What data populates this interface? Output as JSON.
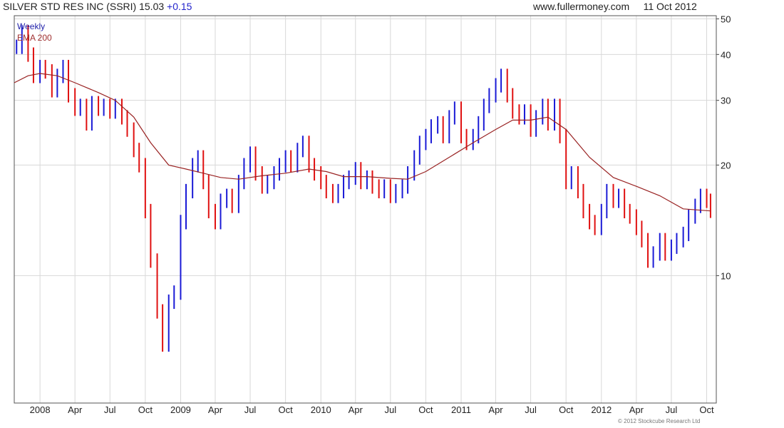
{
  "header": {
    "name_price": "SILVER STD RES INC (SSRI) 15.03",
    "change": "+0.15",
    "source": "www.fullermoney.com",
    "date": "11 Oct 2012"
  },
  "legend": {
    "series1": "Weekly",
    "series2": "EMA 200"
  },
  "copyright": "© 2012 Stockcube Research Ltd",
  "colors": {
    "up": "#1a1ad6",
    "down": "#e01010",
    "ema": "#992222",
    "grid": "#d8d8d8"
  },
  "chart_data": {
    "type": "line",
    "title": "SILVER STD RES INC (SSRI) 15.03 +0.15",
    "y_scale": "log",
    "ylim": [
      4.5,
      51
    ],
    "yticks": [
      10,
      20,
      30,
      40,
      50
    ],
    "xlim": [
      "2007-10-26",
      "2012-10-26"
    ],
    "x_tick_labels": [
      {
        "label": "2008",
        "date": "2008-01-01"
      },
      {
        "label": "Apr",
        "date": "2008-04-01"
      },
      {
        "label": "Jul",
        "date": "2008-07-01"
      },
      {
        "label": "Oct",
        "date": "2008-10-01"
      },
      {
        "label": "2009",
        "date": "2009-01-01"
      },
      {
        "label": "Apr",
        "date": "2009-04-01"
      },
      {
        "label": "Jul",
        "date": "2009-07-01"
      },
      {
        "label": "Oct",
        "date": "2009-10-01"
      },
      {
        "label": "2010",
        "date": "2010-01-01"
      },
      {
        "label": "Apr",
        "date": "2010-04-01"
      },
      {
        "label": "Jul",
        "date": "2010-07-01"
      },
      {
        "label": "Oct",
        "date": "2010-10-01"
      },
      {
        "label": "2011",
        "date": "2011-01-01"
      },
      {
        "label": "Apr",
        "date": "2011-04-01"
      },
      {
        "label": "Jul",
        "date": "2011-07-01"
      },
      {
        "label": "Oct",
        "date": "2011-10-01"
      },
      {
        "label": "2012",
        "date": "2012-01-01"
      },
      {
        "label": "Apr",
        "date": "2012-04-01"
      },
      {
        "label": "Jul",
        "date": "2012-07-01"
      },
      {
        "label": "Oct",
        "date": "2012-10-01"
      }
    ],
    "series": [
      {
        "name": "Weekly",
        "points": [
          [
            "2007-11-01",
            42
          ],
          [
            "2007-11-15",
            46
          ],
          [
            "2007-12-01",
            40
          ],
          [
            "2007-12-15",
            35
          ],
          [
            "2008-01-01",
            37
          ],
          [
            "2008-01-15",
            36
          ],
          [
            "2008-02-01",
            32
          ],
          [
            "2008-02-15",
            35
          ],
          [
            "2008-03-01",
            37
          ],
          [
            "2008-03-15",
            31
          ],
          [
            "2008-04-01",
            28.5
          ],
          [
            "2008-04-15",
            29
          ],
          [
            "2008-05-01",
            26
          ],
          [
            "2008-05-15",
            29.5
          ],
          [
            "2008-06-01",
            28.5
          ],
          [
            "2008-06-15",
            29
          ],
          [
            "2008-07-01",
            28
          ],
          [
            "2008-07-15",
            29
          ],
          [
            "2008-08-01",
            27
          ],
          [
            "2008-08-15",
            25
          ],
          [
            "2008-09-01",
            22
          ],
          [
            "2008-09-15",
            20
          ],
          [
            "2008-10-01",
            15
          ],
          [
            "2008-10-15",
            11
          ],
          [
            "2008-11-01",
            8
          ],
          [
            "2008-11-15",
            6.5
          ],
          [
            "2008-12-01",
            8.5
          ],
          [
            "2008-12-15",
            9
          ],
          [
            "2009-01-01",
            14
          ],
          [
            "2009-01-15",
            17
          ],
          [
            "2009-02-01",
            20
          ],
          [
            "2009-02-15",
            21
          ],
          [
            "2009-03-01",
            18
          ],
          [
            "2009-03-15",
            15
          ],
          [
            "2009-04-01",
            14
          ],
          [
            "2009-04-15",
            16
          ],
          [
            "2009-05-01",
            16.5
          ],
          [
            "2009-05-15",
            15.5
          ],
          [
            "2009-06-01",
            18
          ],
          [
            "2009-06-15",
            20
          ],
          [
            "2009-07-01",
            21.5
          ],
          [
            "2009-07-15",
            19
          ],
          [
            "2009-08-01",
            17.5
          ],
          [
            "2009-08-15",
            18
          ],
          [
            "2009-09-01",
            19
          ],
          [
            "2009-09-15",
            20
          ],
          [
            "2009-10-01",
            21
          ],
          [
            "2009-10-15",
            20
          ],
          [
            "2009-11-01",
            22
          ],
          [
            "2009-11-15",
            23
          ],
          [
            "2009-12-01",
            20
          ],
          [
            "2009-12-15",
            19
          ],
          [
            "2010-01-01",
            18
          ],
          [
            "2010-01-15",
            17
          ],
          [
            "2010-02-01",
            16.5
          ],
          [
            "2010-02-15",
            17
          ],
          [
            "2010-03-01",
            18
          ],
          [
            "2010-03-15",
            18.5
          ],
          [
            "2010-04-01",
            19.5
          ],
          [
            "2010-04-15",
            18
          ],
          [
            "2010-05-01",
            18.5
          ],
          [
            "2010-05-15",
            17.5
          ],
          [
            "2010-06-01",
            17
          ],
          [
            "2010-06-15",
            17.5
          ],
          [
            "2010-07-01",
            16.5
          ],
          [
            "2010-07-15",
            17
          ],
          [
            "2010-08-01",
            17.5
          ],
          [
            "2010-08-15",
            19
          ],
          [
            "2010-09-01",
            21
          ],
          [
            "2010-09-15",
            23
          ],
          [
            "2010-10-01",
            24
          ],
          [
            "2010-10-15",
            25.5
          ],
          [
            "2010-11-01",
            26
          ],
          [
            "2010-11-15",
            24
          ],
          [
            "2010-12-01",
            27
          ],
          [
            "2010-12-15",
            28.5
          ],
          [
            "2011-01-01",
            24
          ],
          [
            "2011-01-15",
            23
          ],
          [
            "2011-02-01",
            24
          ],
          [
            "2011-02-15",
            26
          ],
          [
            "2011-03-01",
            29
          ],
          [
            "2011-03-15",
            31
          ],
          [
            "2011-04-01",
            33
          ],
          [
            "2011-04-15",
            35
          ],
          [
            "2011-05-01",
            31
          ],
          [
            "2011-05-15",
            28
          ],
          [
            "2011-06-01",
            27
          ],
          [
            "2011-06-15",
            28
          ],
          [
            "2011-07-01",
            25
          ],
          [
            "2011-07-15",
            27
          ],
          [
            "2011-08-01",
            29
          ],
          [
            "2011-08-15",
            26
          ],
          [
            "2011-09-01",
            29
          ],
          [
            "2011-09-15",
            24
          ],
          [
            "2011-10-01",
            18
          ],
          [
            "2011-10-15",
            19
          ],
          [
            "2011-11-01",
            17
          ],
          [
            "2011-11-15",
            15
          ],
          [
            "2011-12-01",
            14
          ],
          [
            "2011-12-15",
            13.5
          ],
          [
            "2012-01-01",
            15
          ],
          [
            "2012-01-15",
            17
          ],
          [
            "2012-02-01",
            16
          ],
          [
            "2012-02-15",
            16.5
          ],
          [
            "2012-03-01",
            15
          ],
          [
            "2012-03-15",
            14.5
          ],
          [
            "2012-04-01",
            13.5
          ],
          [
            "2012-04-15",
            12.5
          ],
          [
            "2012-05-01",
            11
          ],
          [
            "2012-05-15",
            11.5
          ],
          [
            "2012-06-01",
            12.5
          ],
          [
            "2012-06-15",
            11.5
          ],
          [
            "2012-07-01",
            12
          ],
          [
            "2012-07-15",
            12.5
          ],
          [
            "2012-08-01",
            13
          ],
          [
            "2012-08-15",
            14.5
          ],
          [
            "2012-09-01",
            15.5
          ],
          [
            "2012-09-15",
            16.5
          ],
          [
            "2012-10-01",
            16
          ],
          [
            "2012-10-11",
            15.03
          ]
        ]
      },
      {
        "name": "EMA 200",
        "points": [
          [
            "2007-10-26",
            33.5
          ],
          [
            "2007-12-01",
            35
          ],
          [
            "2008-01-01",
            35.5
          ],
          [
            "2008-02-15",
            35
          ],
          [
            "2008-04-01",
            33.5
          ],
          [
            "2008-06-01",
            31.5
          ],
          [
            "2008-07-15",
            30
          ],
          [
            "2008-09-01",
            27
          ],
          [
            "2008-10-15",
            23
          ],
          [
            "2008-12-01",
            20
          ],
          [
            "2009-01-15",
            19.5
          ],
          [
            "2009-03-01",
            19
          ],
          [
            "2009-04-15",
            18.5
          ],
          [
            "2009-06-01",
            18.3
          ],
          [
            "2009-08-01",
            18.7
          ],
          [
            "2009-10-01",
            19
          ],
          [
            "2009-12-01",
            19.5
          ],
          [
            "2010-01-15",
            19.2
          ],
          [
            "2010-03-01",
            18.6
          ],
          [
            "2010-05-01",
            18.6
          ],
          [
            "2010-07-01",
            18.4
          ],
          [
            "2010-08-15",
            18.3
          ],
          [
            "2010-10-01",
            19.2
          ],
          [
            "2010-12-01",
            21
          ],
          [
            "2011-02-01",
            23
          ],
          [
            "2011-04-01",
            25
          ],
          [
            "2011-05-15",
            26.5
          ],
          [
            "2011-07-01",
            26.5
          ],
          [
            "2011-08-15",
            27
          ],
          [
            "2011-10-01",
            25
          ],
          [
            "2011-12-01",
            21
          ],
          [
            "2012-02-01",
            18.5
          ],
          [
            "2012-04-01",
            17.5
          ],
          [
            "2012-06-01",
            16.5
          ],
          [
            "2012-08-01",
            15.2
          ],
          [
            "2012-10-11",
            15
          ]
        ]
      }
    ]
  }
}
